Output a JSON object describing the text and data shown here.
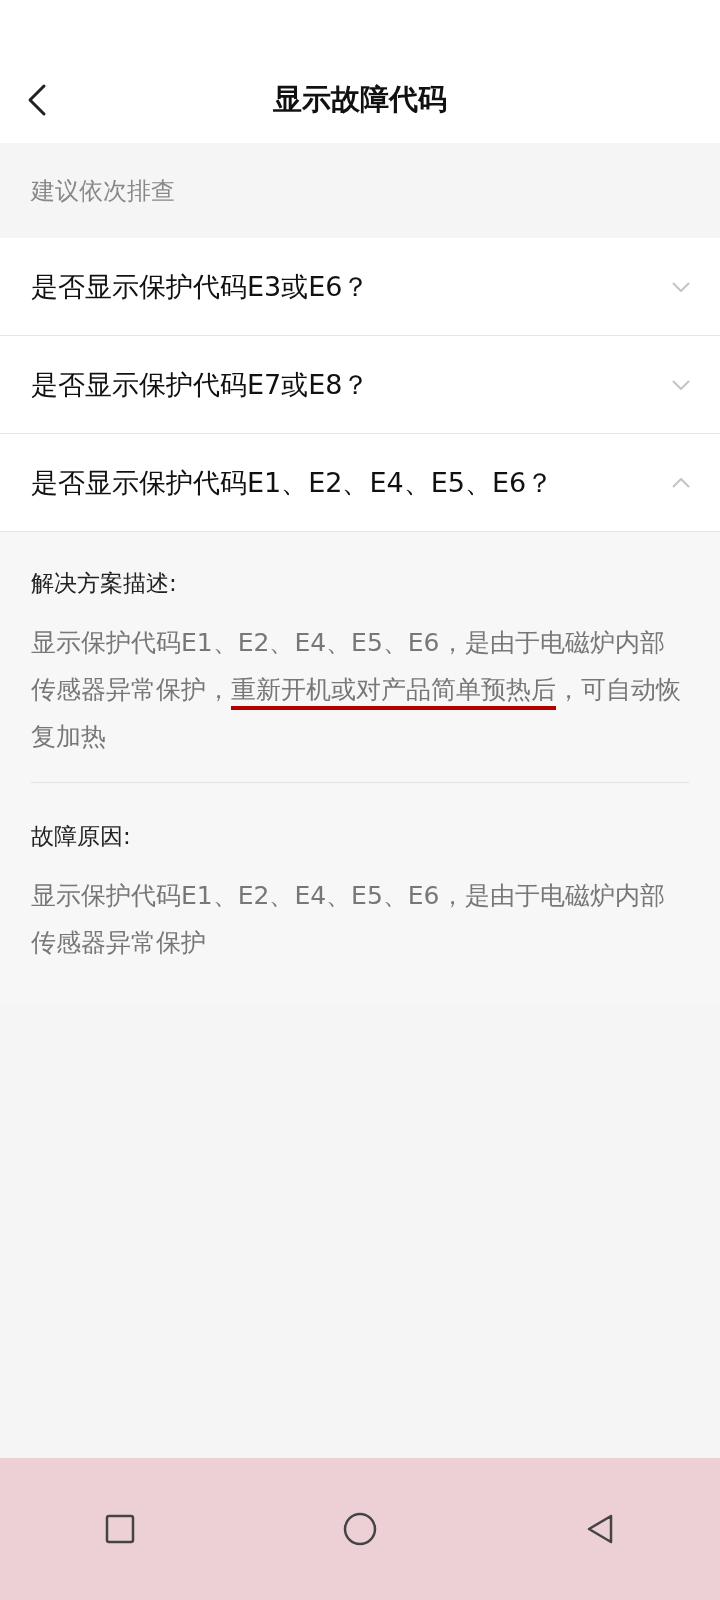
{
  "header": {
    "title": "显示故障代码"
  },
  "hint": "建议依次排查",
  "questions": [
    {
      "text": "是否显示保护代码E3或E6？",
      "expanded": false
    },
    {
      "text": "是否显示保护代码E7或E8？",
      "expanded": false
    },
    {
      "text": "是否显示保护代码E1、E2、E4、E5、E6？",
      "expanded": true,
      "sections": [
        {
          "heading": "解决方案描述:",
          "parts": [
            {
              "text": "显示保护代码E1、E2、E4、E5、E6，是由于电磁炉内部传感器异常保护，",
              "underlined": false
            },
            {
              "text": "重新开机或对产品简单预热后",
              "underlined": true
            },
            {
              "text": "，可自动恢复加热",
              "underlined": false
            }
          ]
        },
        {
          "heading": "故障原因:",
          "parts": [
            {
              "text": "显示保护代码E1、E2、E4、E5、E6，是由于电磁炉内部传感器异常保护",
              "underlined": false
            }
          ]
        }
      ]
    }
  ]
}
